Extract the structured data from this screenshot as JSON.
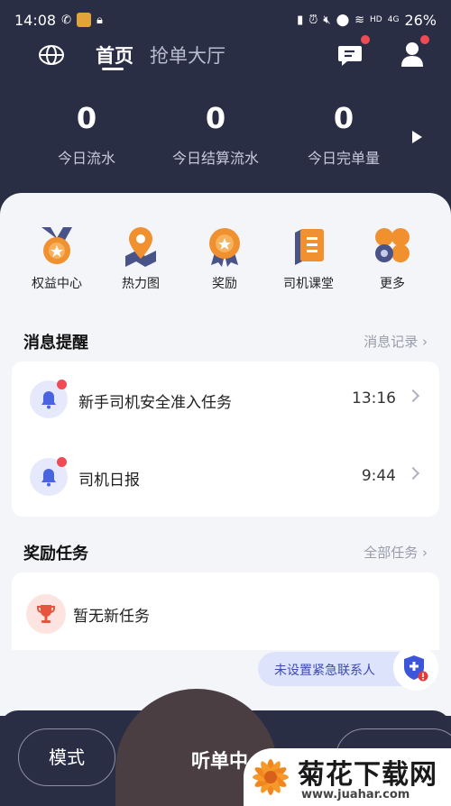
{
  "status_bar": {
    "time": "14:08",
    "battery": "26%",
    "network": "4G",
    "hd": "HD"
  },
  "nav": {
    "tabs": [
      {
        "label": "首页",
        "active": true
      },
      {
        "label": "抢单大厅",
        "active": false
      }
    ]
  },
  "stats": [
    {
      "value": "0",
      "label": "今日流水"
    },
    {
      "value": "0",
      "label": "今日结算流水"
    },
    {
      "value": "0",
      "label": "今日完单量"
    }
  ],
  "shortcuts": [
    {
      "label": "权益中心",
      "icon": "medal-icon"
    },
    {
      "label": "热力图",
      "icon": "map-pin-icon"
    },
    {
      "label": "奖励",
      "icon": "award-icon"
    },
    {
      "label": "司机课堂",
      "icon": "book-icon"
    },
    {
      "label": "更多",
      "icon": "more-icon"
    }
  ],
  "messages_section": {
    "title": "消息提醒",
    "link": "消息记录",
    "items": [
      {
        "text": "新手司机安全准入任务",
        "time": "13:16",
        "unread": true
      },
      {
        "text": "司机日报",
        "time": "9:44",
        "unread": true
      }
    ]
  },
  "rewards_section": {
    "title": "奖励任务",
    "link": "全部任务",
    "empty_text": "暂无新任务"
  },
  "emergency": {
    "label": "未设置紧急联系人"
  },
  "bottom_bar": {
    "mode_label": "模式",
    "listen_label": "听单中"
  },
  "watermark": {
    "title": "菊花下载网",
    "url": "www.juahar.com"
  },
  "colors": {
    "header_bg": "#2a2e45",
    "accent_orange": "#f0902f",
    "alert_red": "#f04a55",
    "link_blue": "#3c4bb3"
  }
}
